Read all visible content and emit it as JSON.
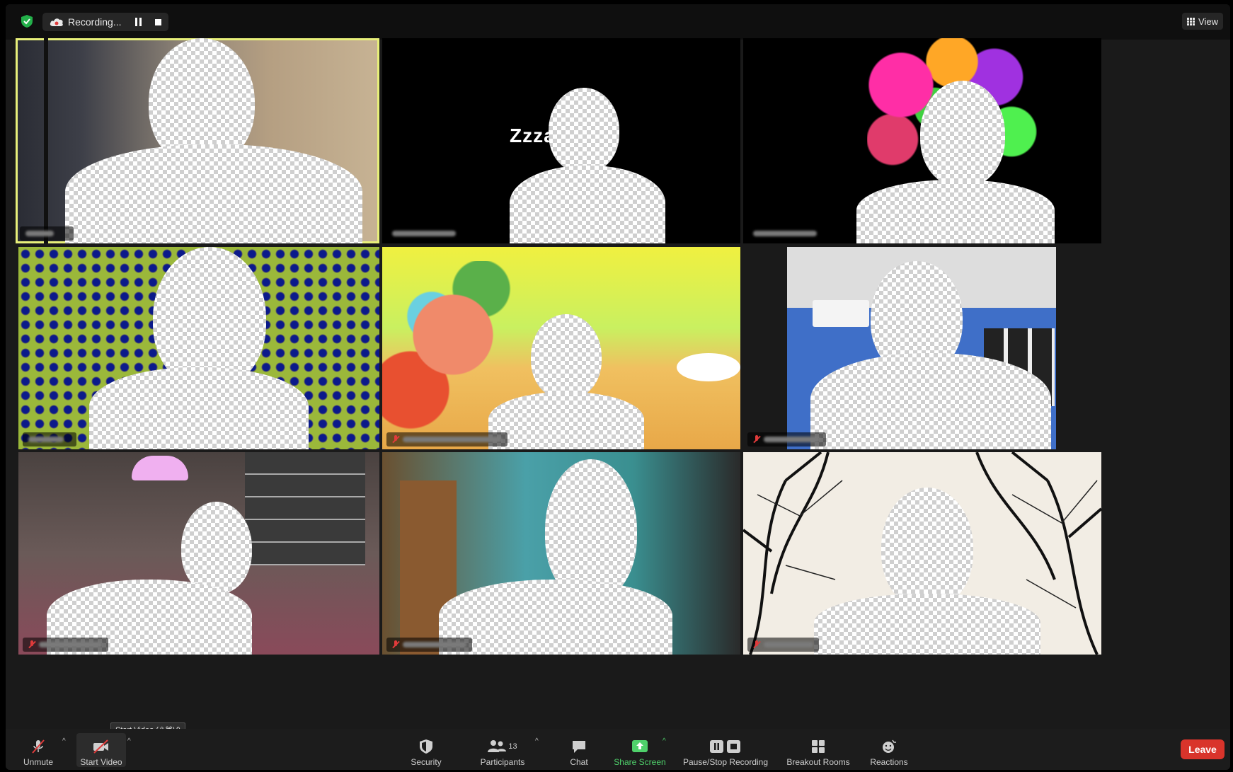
{
  "topbar": {
    "recording_label": "Recording...",
    "view_label": "View"
  },
  "tiles": [
    {
      "name": "tile-1",
      "active": true,
      "label": "",
      "muted": false
    },
    {
      "name": "tile-2",
      "text_overlay": "Zzza",
      "muted": false
    },
    {
      "name": "tile-3",
      "muted": false
    },
    {
      "name": "tile-4",
      "muted": false
    },
    {
      "name": "tile-5",
      "muted": true
    },
    {
      "name": "tile-6",
      "muted": true
    },
    {
      "name": "tile-7",
      "muted": true
    },
    {
      "name": "tile-8",
      "muted": true
    },
    {
      "name": "tile-9",
      "muted": true
    }
  ],
  "toolbar": {
    "unmute_label": "Unmute",
    "start_video_label": "Start Video",
    "start_video_tooltip": "Start Video (⇧⌘V)",
    "security_label": "Security",
    "participants_label": "Participants",
    "participants_count": "13",
    "chat_label": "Chat",
    "share_screen_label": "Share Screen",
    "pause_stop_label": "Pause/Stop Recording",
    "breakout_label": "Breakout Rooms",
    "reactions_label": "Reactions",
    "leave_label": "Leave"
  },
  "colors": {
    "accent_green": "#4fd16b",
    "leave_red": "#d9342b",
    "active_speaker_border": "#e8f07a",
    "muted_red": "#e03b3b"
  }
}
